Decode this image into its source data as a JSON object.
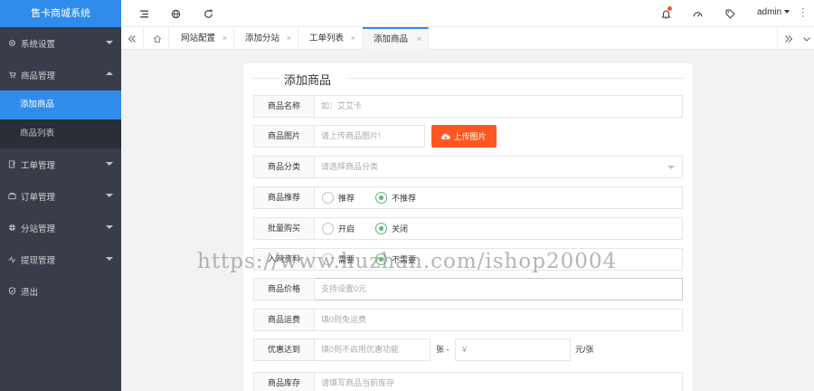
{
  "app": {
    "title": "售卡商城系统"
  },
  "sidebar": {
    "items": [
      {
        "label": "系统设置",
        "icon": "gear-icon"
      },
      {
        "label": "商品管理",
        "icon": "cart-icon",
        "expanded": true,
        "children": [
          "添加商品",
          "商品列表"
        ]
      },
      {
        "label": "工单管理",
        "icon": "ticket-icon"
      },
      {
        "label": "订单管理",
        "icon": "order-icon"
      },
      {
        "label": "分站管理",
        "icon": "globe-icon"
      },
      {
        "label": "提现管理",
        "icon": "pulse-icon"
      },
      {
        "label": "退出",
        "icon": "shield-icon"
      }
    ],
    "active_child": "添加商品"
  },
  "header": {
    "icons": [
      "menu-toggle-icon",
      "globe-icon",
      "refresh-icon",
      "bell-icon",
      "dashboard-icon",
      "tag-icon"
    ],
    "user": "admin"
  },
  "tabs": {
    "items": [
      {
        "label": "网站配置",
        "close": "×"
      },
      {
        "label": "添加分站",
        "close": "×"
      },
      {
        "label": "工单列表",
        "close": "×"
      },
      {
        "label": "添加商品",
        "close": "×",
        "active": true
      }
    ]
  },
  "form": {
    "legend": "添加商品",
    "name": {
      "label": "商品名称",
      "placeholder": "如：艾艾卡"
    },
    "image": {
      "label": "商品图片",
      "placeholder": "请上传商品图片!",
      "button": "上传图片"
    },
    "category": {
      "label": "商品分类",
      "placeholder": "请选择商品分类"
    },
    "recommend": {
      "label": "商品推荐",
      "options": [
        "推荐",
        "不推荐"
      ],
      "selected": "不推荐"
    },
    "bulk": {
      "label": "批量购买",
      "options": [
        "开启",
        "关闭"
      ],
      "selected": "关闭"
    },
    "input_data": {
      "label": "入网资料",
      "options": [
        "需要",
        "不需要"
      ],
      "selected": "不需要"
    },
    "price": {
      "label": "商品价格",
      "placeholder": "支持设置0元"
    },
    "shipping": {
      "label": "商品运费",
      "placeholder": "填0则免运费"
    },
    "discount": {
      "label": "优惠达到",
      "placeholder": "填0则不启用优惠功能",
      "mid": "张 -",
      "price_placeholder": "¥",
      "unit": "元/张"
    },
    "stock": {
      "label": "商品库存",
      "placeholder": "请填写商品当前库存"
    }
  },
  "watermark": "https://www.huzhan.com/ishop20004",
  "colors": {
    "sidebar": "#393d49",
    "accent": "#2f8cea",
    "upload": "#ff5722",
    "radio": "#5fb878"
  }
}
